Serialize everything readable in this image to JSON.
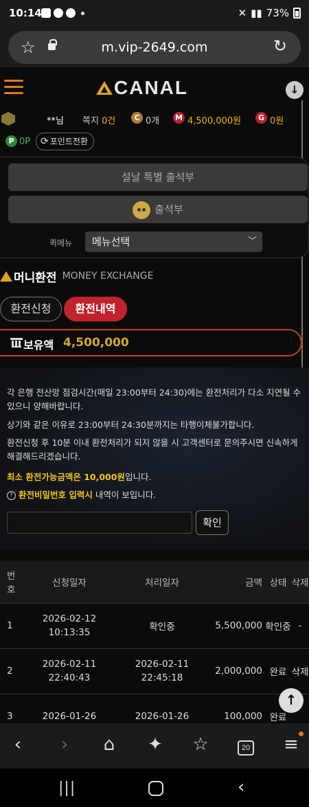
{
  "status_bar": {
    "time": "10:14",
    "battery": "73%"
  },
  "browser": {
    "url": "m.vip-2649.com",
    "tab_count": "20"
  },
  "site": {
    "logo_text": "CANAL",
    "user": {
      "name": "**님",
      "note_label": "쪽지",
      "note_count": "0건",
      "coin_value": "0개",
      "mileage_value": "4,500,000원",
      "gold_value": "0원",
      "point_value": "0P",
      "point_convert_label": "포인트전환"
    },
    "badges": {
      "coin": "C",
      "mileage": "M",
      "gold": "G",
      "point": "P"
    },
    "panel": {
      "event_button": "설날 특별 출석부",
      "attendance_button": "출석부",
      "quick_menu_label": "퀵메뉴",
      "quick_menu_value": "메뉴선택"
    },
    "section": {
      "title_ko": "머니환전",
      "title_en": "MONEY EXCHANGE"
    },
    "tabs": {
      "apply": "환전신청",
      "history": "환전내역"
    },
    "balance": {
      "label": "보유액",
      "value": "4,500,000"
    },
    "notice": {
      "line1": "각 은행 전산망 점검시간(매일 23:00부터 24:30)에는 환전처리가 다소 지연될 수 있으니 양해바랍니다.",
      "line2": "상기와 같은 이유로 23:00부터 24:30분까지는 타행이체불가합니다.",
      "line3": "환전신청 후 10분 이내 환전처리가 되지 않을 시 고객센터로 문의주시면 신속하게 해결해드리겠습니다.",
      "line4_highlight": "최소 환전가능금액은 10,000원",
      "line4_rest": "입니다.",
      "line5_highlight": "환전비밀번호 입력시",
      "line5_rest": " 내역이 보입니다.",
      "confirm_button": "확인"
    },
    "table": {
      "headers": {
        "no": "번호",
        "request_date": "신청일자",
        "process_date": "처리일자",
        "amount": "금액",
        "status": "상태",
        "delete": "삭제"
      },
      "rows": [
        {
          "no": "1",
          "req_date": "2026-02-12",
          "req_time": "10:13:35",
          "proc": "확인중",
          "proc_date": "",
          "proc_time": "",
          "amount": "5,500,000",
          "status": "확인중",
          "delete": "-"
        },
        {
          "no": "2",
          "req_date": "2026-02-11",
          "req_time": "22:40:43",
          "proc": "",
          "proc_date": "2026-02-11",
          "proc_time": "22:45:18",
          "amount": "2,000,000",
          "status": "완료",
          "delete": "삭제"
        },
        {
          "no": "3",
          "req_date": "2026-01-26",
          "req_time": "",
          "proc": "",
          "proc_date": "2026-01-26",
          "proc_time": "",
          "amount": "100,000",
          "status": "완료",
          "delete": ""
        }
      ]
    }
  },
  "colors": {
    "accent_orange": "#e07a23",
    "accent_gold": "#e0a323",
    "tab_red": "#c0232b",
    "balance_border": "#c8401c"
  }
}
